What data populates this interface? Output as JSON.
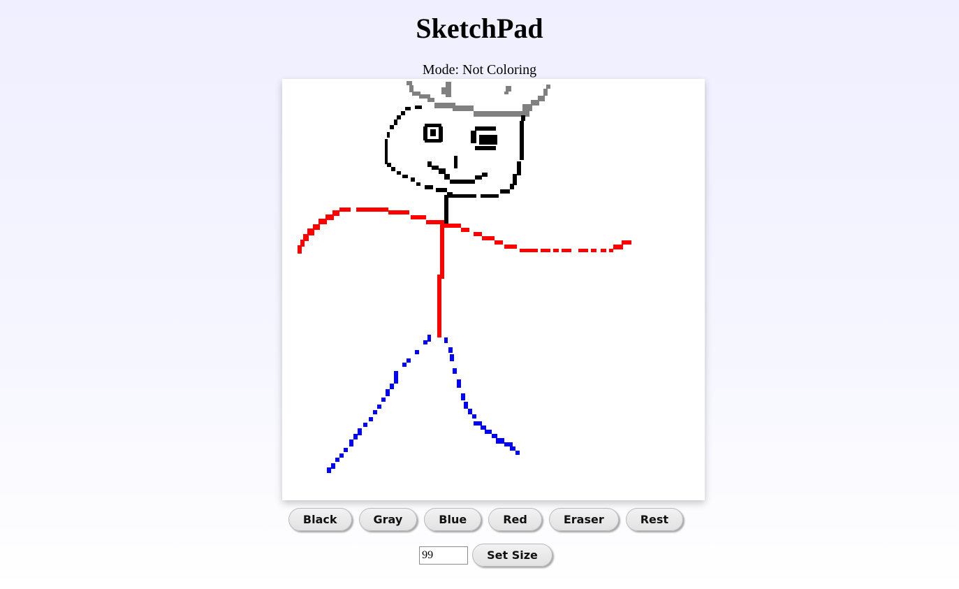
{
  "app": {
    "title": "SketchPad",
    "mode_text": "Mode: Not Coloring"
  },
  "colors": {
    "black": "#000000",
    "gray": "#808080",
    "blue": "#0000ff",
    "red": "#ff0000"
  },
  "toolbar": {
    "buttons": [
      "Black",
      "Gray",
      "Blue",
      "Red",
      "Eraser",
      "Rest"
    ]
  },
  "size": {
    "value": "99",
    "set_label": "Set Size"
  }
}
